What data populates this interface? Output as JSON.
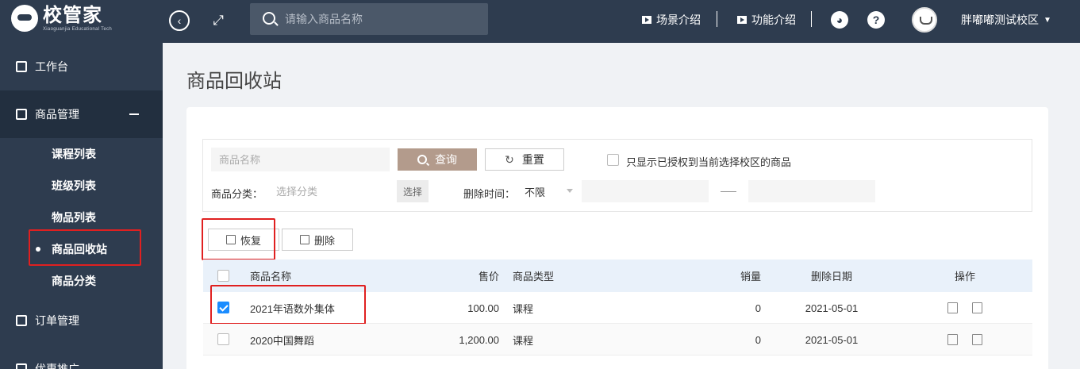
{
  "header": {
    "logo_title": "校管家",
    "logo_sub": "Xiaoguanjia Educational Tech",
    "search_placeholder": "请输入商品名称",
    "link_scene": "场景介绍",
    "link_feature": "功能介绍",
    "help": "?",
    "campus": "胖嘟嘟测试校区"
  },
  "sidebar": {
    "workbench": "工作台",
    "goods_mgmt": "商品管理",
    "sub_items": [
      "课程列表",
      "班级列表",
      "物品列表",
      "商品回收站",
      "商品分类"
    ],
    "active_index": 3,
    "order_mgmt": "订单管理",
    "promo": "优惠推广"
  },
  "page": {
    "title": "商品回收站"
  },
  "filters": {
    "name_placeholder": "商品名称",
    "query": "查询",
    "reset": "重置",
    "only_authorized": "只显示已授权到当前选择校区的商品",
    "category_label": "商品分类：",
    "category_placeholder": "选择分类",
    "category_btn": "选择",
    "delete_time_label": "删除时间：",
    "delete_time_value": "不限"
  },
  "actions": {
    "restore": "恢复",
    "delete": "删除"
  },
  "table": {
    "headers": {
      "name": "商品名称",
      "price": "售价",
      "type": "商品类型",
      "sales": "销量",
      "date": "删除日期",
      "ops": "操作"
    },
    "rows": [
      {
        "checked": true,
        "name": "2021年语数外集体",
        "price": "100.00",
        "type": "课程",
        "sales": "0",
        "date": "2021-05-01"
      },
      {
        "checked": false,
        "name": "2020中国舞蹈",
        "price": "1,200.00",
        "type": "课程",
        "sales": "0",
        "date": "2021-05-01"
      }
    ]
  },
  "colors": {
    "nav_bg": "#2e3c4f",
    "query_btn": "#b39b8c",
    "checkbox": "#1a8cff",
    "highlight": "#e02020"
  }
}
